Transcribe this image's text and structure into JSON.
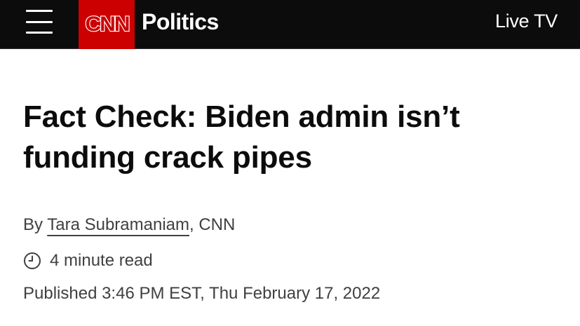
{
  "header": {
    "brand": "CNN",
    "section": "Politics",
    "live_tv": "Live TV",
    "brand_color": "#cc0000",
    "menu_icon": "hamburger-menu-icon"
  },
  "article": {
    "headline": "Fact Check: Biden admin isn’t funding crack pipes",
    "byline_prefix": "By ",
    "author": "Tara Subramaniam",
    "byline_suffix": ", CNN",
    "read_time": "4 minute read",
    "read_time_icon": "clock-icon",
    "published": "Published 3:46 PM EST, Thu February 17, 2022"
  }
}
